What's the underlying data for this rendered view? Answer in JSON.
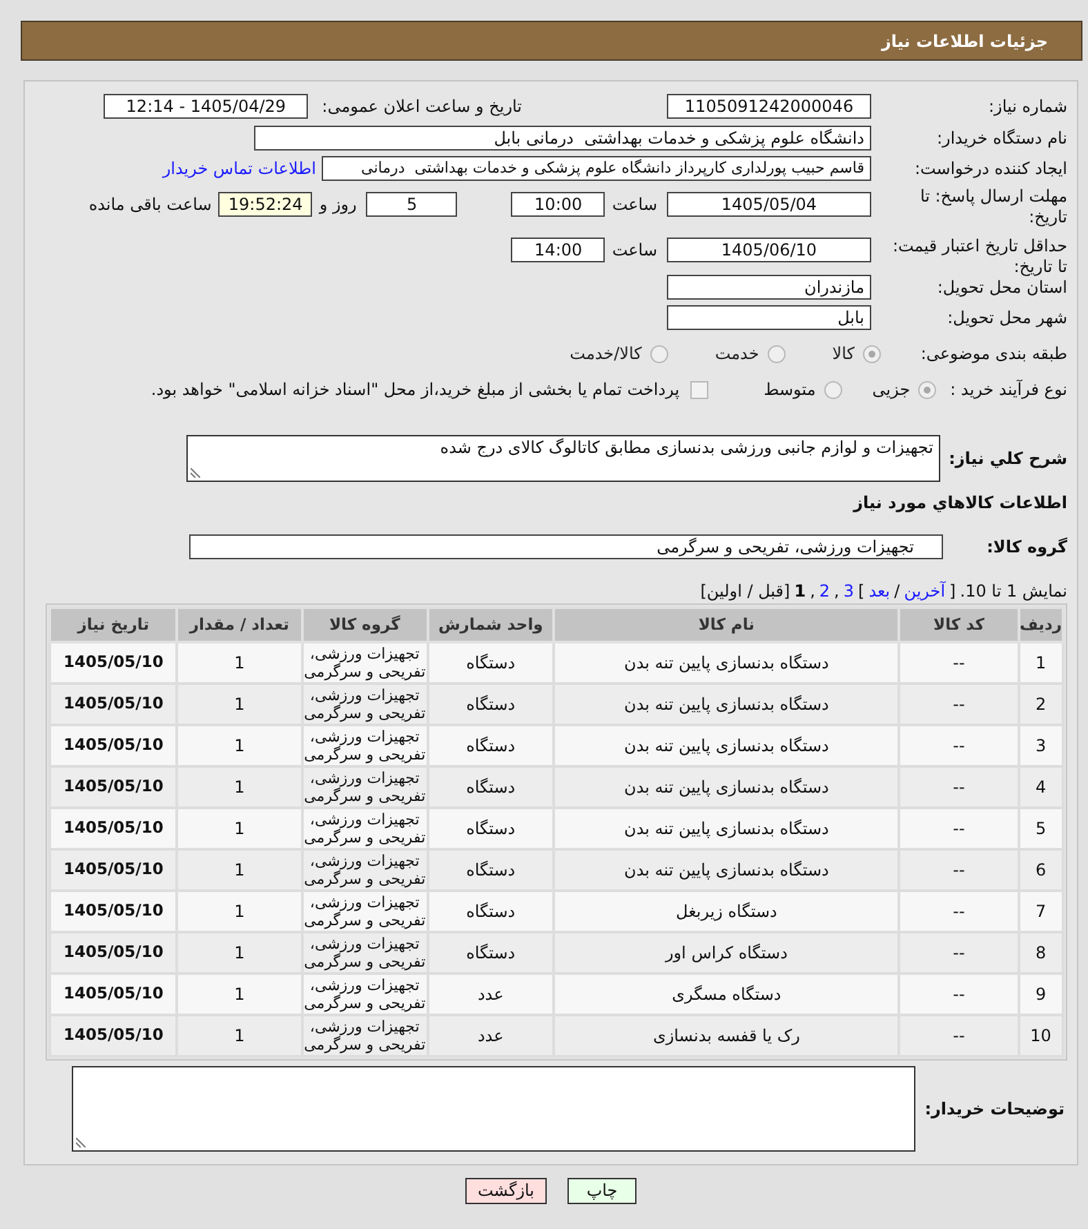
{
  "header": {
    "title": "جزئیات اطلاعات نیاز"
  },
  "form": {
    "need_number": {
      "label": "شماره نیاز:",
      "value": "1105091242000046"
    },
    "announce": {
      "label": "تاریخ و ساعت اعلان عمومی:",
      "value": "1405/04/29 - 12:14"
    },
    "buyer_org": {
      "label": "نام دستگاه خریدار:",
      "value": "دانشگاه علوم پزشکی و خدمات بهداشتی  درمانی بابل"
    },
    "requester": {
      "label": "ایجاد کننده درخواست:",
      "value": "قاسم حبیب پورلداری کارپرداز دانشگاه علوم پزشکی و خدمات بهداشتی  درمانی",
      "link": "اطلاعات تماس خریدار"
    },
    "deadline": {
      "label": "مهلت ارسال پاسخ: تا تاریخ:",
      "date": "1405/05/04",
      "time_label": "ساعت",
      "time": "10:00",
      "days": "5",
      "days_label": "روز و",
      "remaining": "19:52:24",
      "remaining_label": "ساعت باقی مانده"
    },
    "validity": {
      "label": "حداقل تاریخ اعتبار قیمت: تا تاریخ:",
      "date": "1405/06/10",
      "time_label": "ساعت",
      "time": "14:00"
    },
    "province": {
      "label": "استان محل تحویل:",
      "value": "مازندران"
    },
    "city": {
      "label": "شهر محل تحویل:",
      "value": "بابل"
    },
    "category": {
      "label": "طبقه بندی موضوعی:",
      "options": [
        {
          "label": "کالا",
          "selected": true,
          "disabled": true
        },
        {
          "label": "خدمت",
          "selected": false,
          "disabled": true
        },
        {
          "label": "کالا/خدمت",
          "selected": false,
          "disabled": true
        }
      ]
    },
    "process": {
      "label": "نوع فرآیند خرید :",
      "options": [
        {
          "label": "جزیی",
          "selected": true,
          "disabled": true
        },
        {
          "label": "متوسط",
          "selected": false,
          "disabled": true
        }
      ],
      "treasury": {
        "label": "پرداخت تمام یا بخشی از مبلغ خرید،از محل \"اسناد خزانه اسلامی\" خواهد بود.",
        "checked": false,
        "disabled": true
      }
    }
  },
  "description": {
    "label": "شرح کلي نیاز:",
    "value": "تجهیزات و لوازم جانبی ورزشی بدنسازی مطابق کاتالوگ کالای درج شده"
  },
  "items_heading": "اطلاعات کالاهاي مورد نیاز",
  "goods_group": {
    "label": "گروه کالا:",
    "value": "تجهیزات ورزشی، تفریحی و سرگرمی"
  },
  "pagination": [
    {
      "kind": "text",
      "text": "نمایش 1 تا 10."
    },
    {
      "kind": "text",
      "text": "["
    },
    {
      "kind": "link",
      "text": "آخرین"
    },
    {
      "kind": "text",
      "text": "/"
    },
    {
      "kind": "link",
      "text": "بعد"
    },
    {
      "kind": "text",
      "text": "]"
    },
    {
      "kind": "page",
      "text": "3",
      "selected": false
    },
    {
      "kind": "text",
      "text": ","
    },
    {
      "kind": "page",
      "text": "2",
      "selected": false
    },
    {
      "kind": "text",
      "text": ","
    },
    {
      "kind": "page",
      "text": "1",
      "selected": true
    },
    {
      "kind": "text",
      "text": "[قبل / اولین]"
    }
  ],
  "table": {
    "columns": [
      "ردیف",
      "کد کالا",
      "نام کالا",
      "واحد شمارش",
      "گروه کالا",
      "تعداد / مقدار",
      "تاریخ نیاز"
    ],
    "rows": [
      [
        "1",
        "--",
        "دستگاه بدنسازی پایین تنه بدن",
        "دستگاه",
        "تجهیزات ورزشی، تفریحی و سرگرمی",
        "1",
        "1405/05/10"
      ],
      [
        "2",
        "--",
        "دستگاه بدنسازی پایین تنه بدن",
        "دستگاه",
        "تجهیزات ورزشی، تفریحی و سرگرمی",
        "1",
        "1405/05/10"
      ],
      [
        "3",
        "--",
        "دستگاه بدنسازی پایین تنه بدن",
        "دستگاه",
        "تجهیزات ورزشی، تفریحی و سرگرمی",
        "1",
        "1405/05/10"
      ],
      [
        "4",
        "--",
        "دستگاه بدنسازی پایین تنه بدن",
        "دستگاه",
        "تجهیزات ورزشی، تفریحی و سرگرمی",
        "1",
        "1405/05/10"
      ],
      [
        "5",
        "--",
        "دستگاه بدنسازی پایین تنه بدن",
        "دستگاه",
        "تجهیزات ورزشی، تفریحی و سرگرمی",
        "1",
        "1405/05/10"
      ],
      [
        "6",
        "--",
        "دستگاه بدنسازی پایین تنه بدن",
        "دستگاه",
        "تجهیزات ورزشی، تفریحی و سرگرمی",
        "1",
        "1405/05/10"
      ],
      [
        "7",
        "--",
        "دستگاه زیربغل",
        "دستگاه",
        "تجهیزات ورزشی، تفریحی و سرگرمی",
        "1",
        "1405/05/10"
      ],
      [
        "8",
        "--",
        "دستگاه کراس اور",
        "دستگاه",
        "تجهیزات ورزشی، تفریحی و سرگرمی",
        "1",
        "1405/05/10"
      ],
      [
        "9",
        "--",
        "دستگاه مسگری",
        "عدد",
        "تجهیزات ورزشی، تفریحی و سرگرمی",
        "1",
        "1405/05/10"
      ],
      [
        "10",
        "--",
        "رک یا قفسه بدنسازی",
        "عدد",
        "تجهیزات ورزشی، تفریحی و سرگرمی",
        "1",
        "1405/05/10"
      ]
    ]
  },
  "buyer_notes": {
    "label": "توضیحات خریدار:"
  },
  "buttons": [
    {
      "kind": "print",
      "label": "چاپ"
    },
    {
      "kind": "back",
      "label": "بازگشت"
    }
  ]
}
